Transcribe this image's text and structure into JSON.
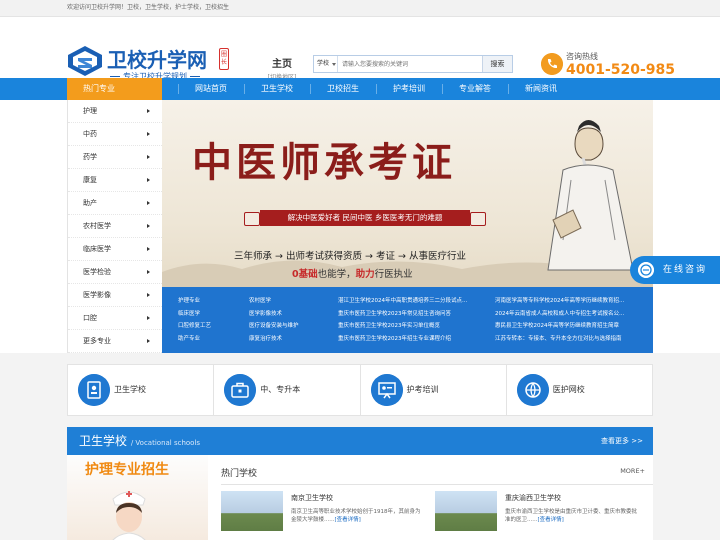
{
  "topbar": {
    "welcome": "欢迎访问卫校升学网！卫校，卫生学校，护士学校，卫校招生"
  },
  "logo": {
    "name": "卫校升学网",
    "seal": "圈长",
    "slogan": "专注卫校升学规划"
  },
  "city": {
    "main": "主页",
    "switch": "[切换地区]"
  },
  "search": {
    "select_value": "学校",
    "placeholder": "请输入您要搜索的关键词",
    "button": "搜索"
  },
  "hotline": {
    "label": "咨询热线",
    "number": "4001-520-985"
  },
  "nav": {
    "hot": "热门专业",
    "items": [
      "网站首页",
      "卫生学校",
      "卫校招生",
      "护考培训",
      "专业解答",
      "新闻资讯"
    ]
  },
  "sidebar": {
    "items": [
      "护理",
      "中药",
      "药学",
      "康复",
      "助产",
      "农村医学",
      "临床医学",
      "医学检验",
      "医学影像",
      "口腔",
      "更多专业"
    ]
  },
  "banner": {
    "title": "中医师承考证",
    "ribbon": "解决中医爱好者 民间中医 乡医医考无门的难题",
    "steps": "三年师承 → 出师考试获得资质 → 考证 → 从事医疗行业",
    "sub_pre": "0基础",
    "sub_mid": "也能学，",
    "sub_strong": "助力",
    "sub_post": "行医执业"
  },
  "links": {
    "col1": [
      "护理专业",
      "临床医学",
      "口腔修复工艺",
      "助产专业"
    ],
    "col2": [
      "农村医学",
      "医学影像技术",
      "医疗设备安装与维护",
      "康复治疗技术"
    ],
    "col3": [
      "湛江卫生学校2024年中高职贯通培养三二分段试点...",
      "重庆市医药卫生学校2023年常见招生咨询问答",
      "重庆市医药卫生学校2023年实习单位概览",
      "重庆市医药卫生学校2023年招生专业课程介绍"
    ],
    "col4": [
      "河南医学高等专科学校2024年高等学历继续教育招...",
      "2024年云南省成人高校和成人中专招生考试报名公...",
      "惠民县卫生学校2024年高等学历继续教育招生简章",
      "江苏专转本：专接本、专升本全方位对比与选择指南"
    ]
  },
  "chat": {
    "label": "在线咨询"
  },
  "categories": [
    "卫生学校",
    "中、专升本",
    "护考培训",
    "医护网校"
  ],
  "section": {
    "title": "卫生学校",
    "subtitle": "/ Vocational schools",
    "more": "查看更多 >>",
    "promo": "护理专业招生",
    "hot_title": "热门学校",
    "hot_more": "MORE+",
    "schools": [
      {
        "name": "南京卫生学校",
        "desc": "南京卫生高等职业技术学校始创于1918年，其前身为金陵大学鼓楼......",
        "link": "[查看详情]"
      },
      {
        "name": "重庆渝西卫生学校",
        "desc": "重庆市渝西卫生学校是由重庆市卫计委、重庆市教委批准的医卫......",
        "link": "[查看详情]"
      }
    ]
  },
  "colors": {
    "brand_blue": "#1a84dc",
    "accent_orange": "#f39c1c",
    "banner_red": "#a51e1e"
  }
}
